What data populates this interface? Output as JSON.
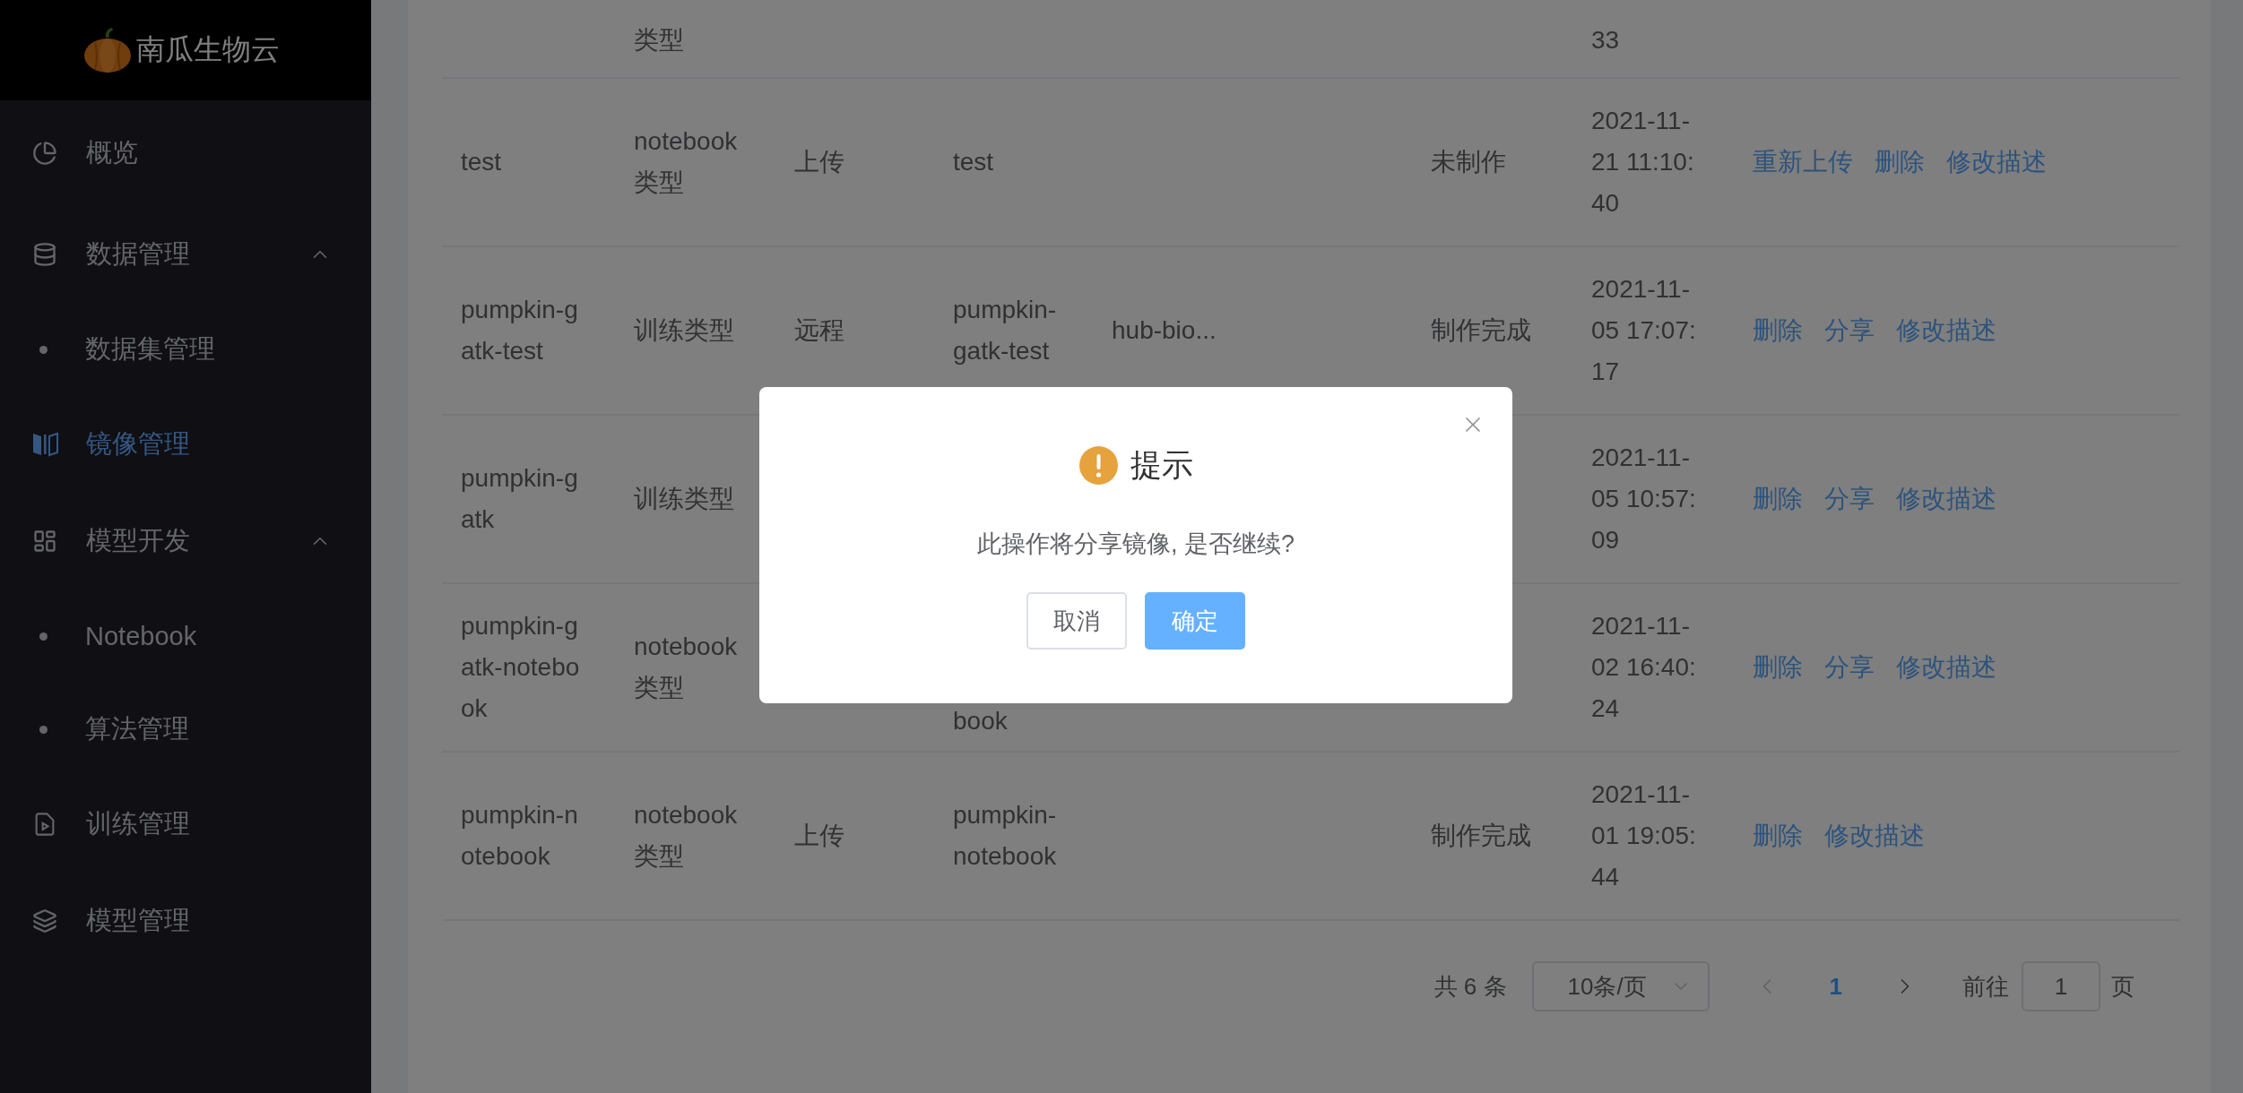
{
  "logo": {
    "text": "南瓜生物云"
  },
  "sidebar": {
    "items": [
      {
        "label": "概览",
        "selected": false
      },
      {
        "label": "数据管理",
        "selected": false,
        "expanded": true,
        "children": [
          {
            "label": "数据集管理",
            "selected": false
          }
        ]
      },
      {
        "label": "镜像管理",
        "selected": true
      },
      {
        "label": "模型开发",
        "selected": false,
        "expanded": true,
        "children": [
          {
            "label": "Notebook",
            "selected": false
          },
          {
            "label": "算法管理",
            "selected": false
          }
        ]
      },
      {
        "label": "训练管理",
        "selected": false
      },
      {
        "label": "模型管理",
        "selected": false
      }
    ]
  },
  "table": {
    "rows": [
      {
        "kind": "cut",
        "type": "类型",
        "time": "33"
      },
      {
        "name": "test",
        "type": "notebook类型",
        "source": "上传",
        "column_4": "test",
        "status": "未制作",
        "time": "2021-11-21 11:10:40",
        "actions": [
          "重新上传",
          "删除",
          "修改描述"
        ]
      },
      {
        "name": "pumpkin-gatk-test",
        "type": "训练类型",
        "source": "远程",
        "column_4": "pumpkin-gatk-test",
        "column_5": "hub-bio...",
        "status": "制作完成",
        "time": "2021-11-05 17:07:17",
        "actions": [
          "删除",
          "分享",
          "修改描述"
        ]
      },
      {
        "name": "pumpkin-gatk",
        "type": "训练类型",
        "time": "2021-11-05 10:57:09",
        "actions": [
          "删除",
          "分享",
          "修改描述"
        ]
      },
      {
        "name": "pumpkin-gatk-notebook",
        "type": "notebook类型",
        "column_4": {
          "kind": "last-line",
          "text": "book"
        },
        "time": "2021-11-02 16:40:24",
        "actions": [
          "删除",
          "分享",
          "修改描述"
        ]
      },
      {
        "name": "pumpkin-notebook",
        "type": "notebook类型",
        "source": "上传",
        "column_4": "pumpkin-notebook",
        "status": "制作完成",
        "time": "2021-11-01 19:05:44",
        "actions": [
          "删除",
          "修改描述"
        ]
      }
    ]
  },
  "pagination": {
    "total": "共 6 条",
    "page_size": "10条/页",
    "pages": [
      {
        "label": "1",
        "selected": true
      }
    ],
    "goto_label": "前往",
    "goto_value": "1",
    "goto_suffix": "页"
  },
  "dialog": {
    "title": "提示",
    "message": "此操作将分享镜像, 是否继续?",
    "buttons": [
      {
        "kind": "cancel",
        "label": "取消"
      },
      {
        "kind": "primary",
        "label": "确定"
      }
    ]
  }
}
